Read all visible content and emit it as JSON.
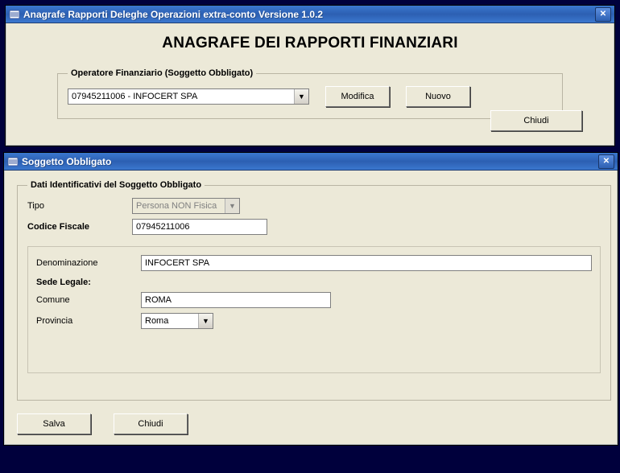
{
  "win1": {
    "title": "Anagrafe Rapporti Deleghe Operazioni extra-conto Versione 1.0.2",
    "big_title": "ANAGRAFE DEI RAPPORTI FINANZIARI",
    "group_legend": "Operatore Finanziario (Soggetto Obbligato)",
    "operator_selected": "07945211006 - INFOCERT SPA",
    "btn_modifica": "Modifica",
    "btn_nuovo": "Nuovo",
    "btn_chiudi": "Chiudi"
  },
  "win2": {
    "title": "Soggetto Obbligato",
    "group_legend": "Dati Identificativi del Soggetto Obbligato",
    "lbl_tipo": "Tipo",
    "tipo_value": "Persona NON Fisica",
    "lbl_cf": "Codice Fiscale",
    "cf_value": "07945211006",
    "lbl_denominazione": "Denominazione",
    "denominazione_value": "INFOCERT SPA",
    "lbl_sede": "Sede Legale:",
    "lbl_comune": "Comune",
    "comune_value": "ROMA",
    "lbl_provincia": "Provincia",
    "provincia_value": "Roma",
    "btn_salva": "Salva",
    "btn_chiudi": "Chiudi"
  }
}
